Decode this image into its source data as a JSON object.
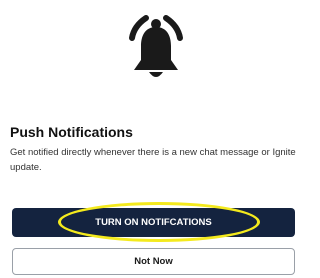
{
  "header": {
    "icon": "bell-ringing-icon"
  },
  "content": {
    "title": "Push Notifications",
    "description": "Get notified directly whenever there is a new chat message or Ignite update."
  },
  "actions": {
    "primary_label": "TURN ON NOTIFCATIONS",
    "secondary_label": "Not Now"
  },
  "colors": {
    "primary_button": "#14233f",
    "highlight_annotation": "#f4ea1d",
    "text": "#1f1f1f"
  }
}
